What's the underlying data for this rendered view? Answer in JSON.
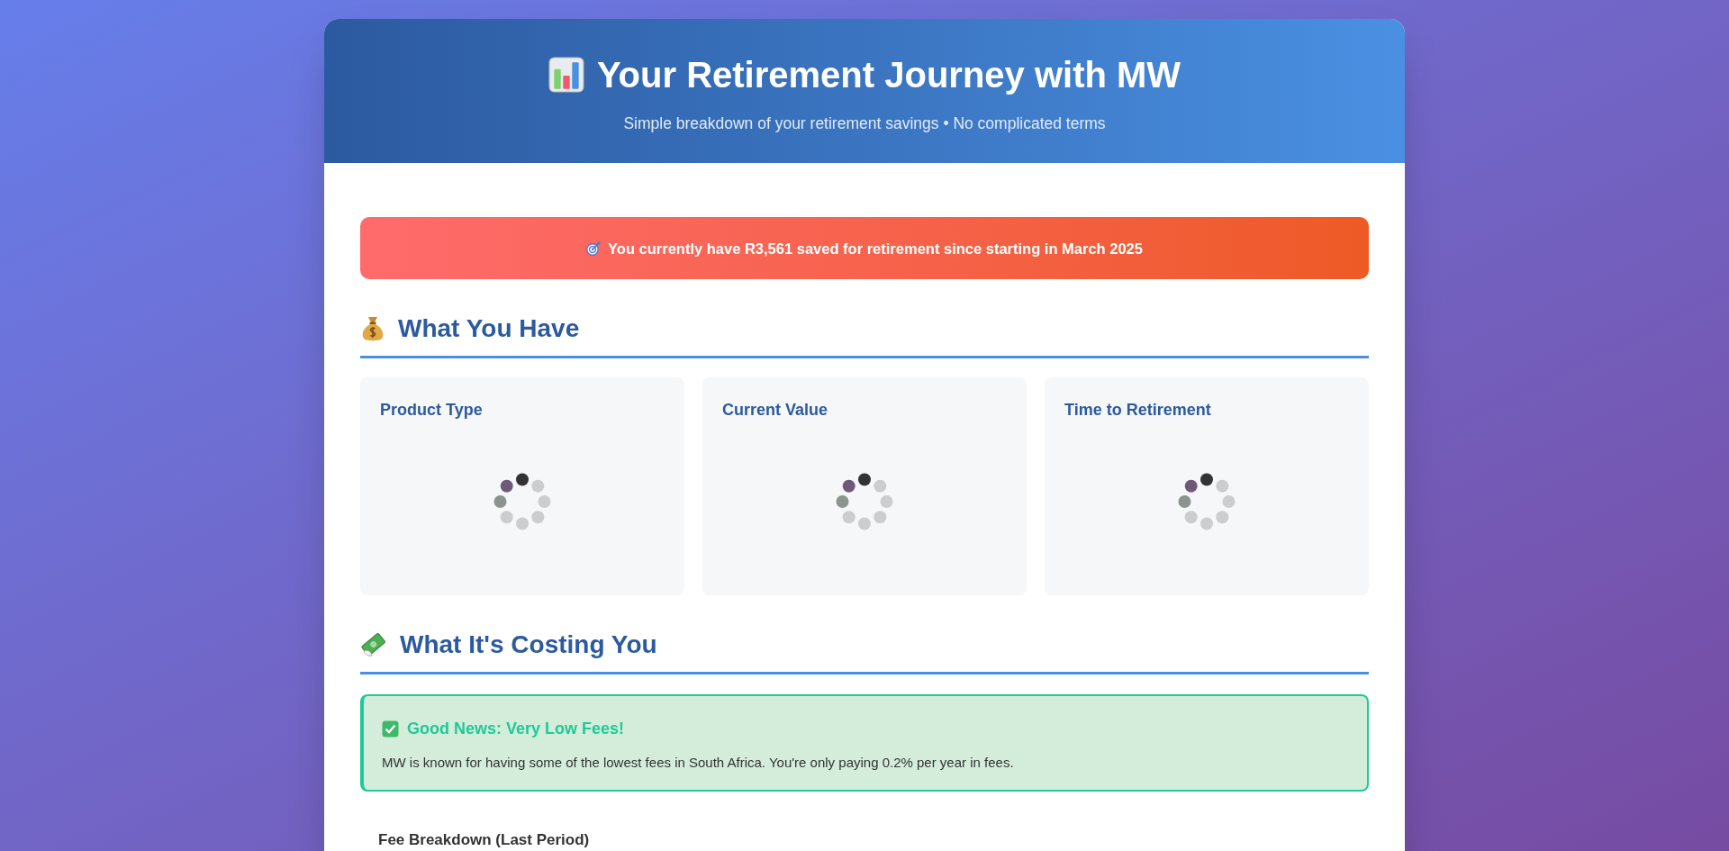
{
  "header": {
    "title": "Your Retirement Journey with MW",
    "subtitle": "Simple breakdown of your retirement savings • No complicated terms"
  },
  "banner": {
    "text": "You currently have **R3,561** saved for retirement since starting in March 2025"
  },
  "sections": [
    {
      "kind": "holdings",
      "title": "What You Have",
      "cards": [
        {
          "label": "Product Type",
          "loading": true
        },
        {
          "label": "Current Value",
          "loading": true
        },
        {
          "label": "Time to Retirement",
          "loading": true
        }
      ]
    },
    {
      "kind": "costs",
      "title": "What It's Costing You",
      "notice": {
        "title": "Good News: Very Low Fees!",
        "text": "MW is known for having some of the lowest fees in South Africa. You're only paying 0.2% per year in fees."
      },
      "subheading": "Fee Breakdown (Last Period)"
    }
  ]
}
